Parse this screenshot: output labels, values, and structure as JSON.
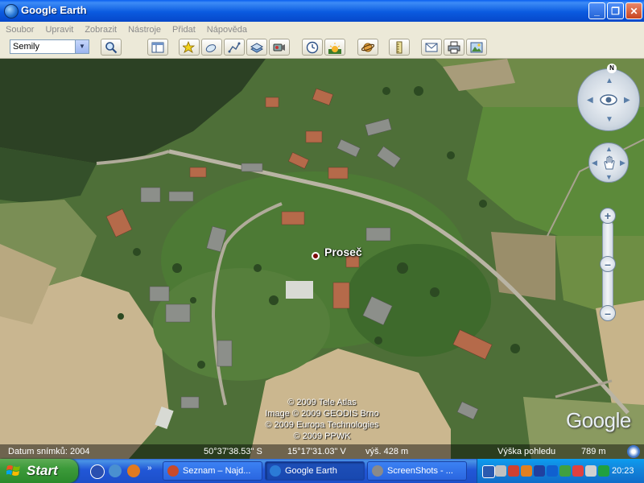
{
  "window": {
    "title": "Google Earth",
    "minimize": "_",
    "maximize": "❐",
    "close": "✕"
  },
  "menu": [
    "Soubor",
    "Upravit",
    "Zobrazit",
    "Nástroje",
    "Přidat",
    "Nápověda"
  ],
  "toolbar": {
    "search_value": "Semily",
    "buttons": [
      "search-icon",
      "sidebar-icon",
      "placemark-icon",
      "polygon-icon",
      "path-icon",
      "overlay-icon",
      "tour-icon",
      "clock-icon",
      "sun-icon",
      "planet-icon",
      "ruler-icon",
      "email-icon",
      "print-icon",
      "image-icon"
    ]
  },
  "map": {
    "place_label": "Proseč",
    "credits": [
      "© 2009 Tele Atlas",
      "Image © 2009 GEODIS Brno",
      "© 2009 Europa Technologies",
      "© 2009 PPWK"
    ],
    "logo": "Google",
    "north_label": "N"
  },
  "status": {
    "image_date_label": "Datum snímků: 2004",
    "latitude": "50°37'38.53\" S",
    "longitude": "15°17'31.03\" V",
    "elevation": "výš.  428 m",
    "eye_alt_label": "Výška pohledu",
    "eye_alt_value": "789 m"
  },
  "taskbar": {
    "start_label": "Start",
    "tasks": [
      {
        "label": "Seznam – Najd...",
        "icon_color": "#c84a2a",
        "active": false
      },
      {
        "label": "Google Earth",
        "icon_color": "#2b7bd6",
        "active": true
      },
      {
        "label": "ScreenShots - ...",
        "icon_color": "#8a8a8a",
        "active": false
      }
    ],
    "clock": "20:23"
  }
}
